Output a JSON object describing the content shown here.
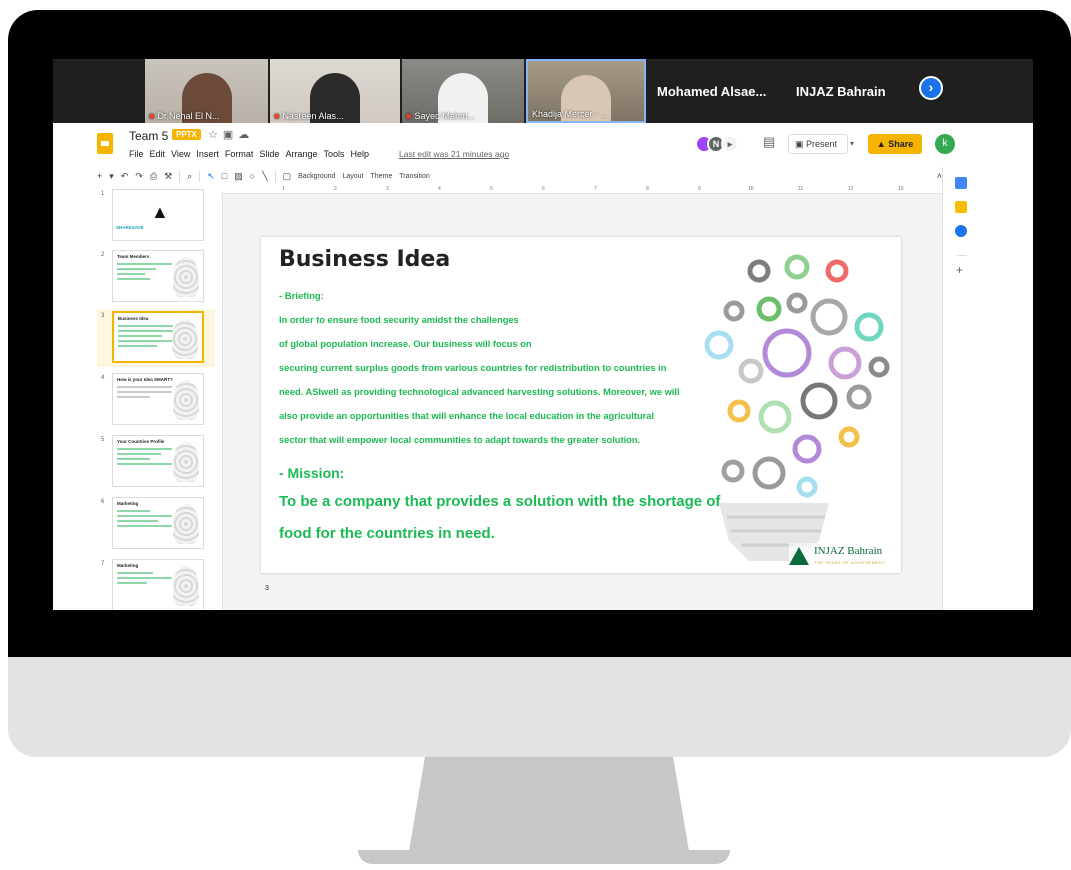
{
  "meet": {
    "participants": [
      {
        "name": "Dr.Nehal El N...",
        "muted": true
      },
      {
        "name": "Nasreen Alas...",
        "muted": true
      },
      {
        "name": "Sayed Mahm...",
        "muted": true
      },
      {
        "name": "Khadija Mercer - ...",
        "muted": false
      }
    ],
    "name_tiles": [
      "Mohamed  Alsae...",
      "INJAZ Bahrain"
    ]
  },
  "slides_app": {
    "doc_title": "Team 5",
    "badge": "PPTX",
    "menu": [
      "File",
      "Edit",
      "View",
      "Insert",
      "Format",
      "Slide",
      "Arrange",
      "Tools",
      "Help"
    ],
    "last_edit": "Last edit was 21 minutes ago",
    "present_label": "Present",
    "share_label": "Share",
    "account_initial": "k",
    "collaborator_initial": "N",
    "toolbar": {
      "background": "Background",
      "layout": "Layout",
      "theme": "Theme",
      "transition": "Transition"
    },
    "ruler_ticks": [
      "1",
      "2",
      "3",
      "4",
      "5",
      "6",
      "7",
      "8",
      "9",
      "10",
      "11",
      "12",
      "13"
    ],
    "filmstrip": [
      {
        "number": "1",
        "title": "",
        "label": "SHARESAVE"
      },
      {
        "number": "2",
        "title": "Team Members",
        "label": ""
      },
      {
        "number": "3",
        "title": "Business Idea",
        "label": ""
      },
      {
        "number": "4",
        "title": "How is your Idea SMART?",
        "label": ""
      },
      {
        "number": "5",
        "title": "Your Countries Profile",
        "label": ""
      },
      {
        "number": "6",
        "title": "Marketing",
        "label": ""
      },
      {
        "number": "7",
        "title": "Marketing",
        "label": ""
      }
    ]
  },
  "slide": {
    "title": "Business Idea",
    "briefing_label": "- Briefing:",
    "body": [
      "In order to ensure food security amidst the challenges",
      "of global population increase. Our business will focus on",
      "securing current surplus goods from various countries for redistribution to countries in",
      "need. ASIwell as  providing technological advanced harvesting solutions. Moreover, we will",
      "also provide an opportunities  that will enhance the local education in  the agricultural",
      "sector that  will empower local communities to  adapt towards the greater solution."
    ],
    "mission_label": "- Mission:",
    "mission": [
      "To be a company that provides a solution with the shortage of",
      "food for the countries in need."
    ],
    "logo_name": "INJAZ Bahrain",
    "logo_tagline": "THE YEARS OF ACHIEVEMENT",
    "number": "3"
  },
  "colors": {
    "accent_green": "#1db954",
    "slides_yellow": "#f4b400",
    "meet_blue": "#1a73e8",
    "mic_off_red": "#ea4335"
  }
}
